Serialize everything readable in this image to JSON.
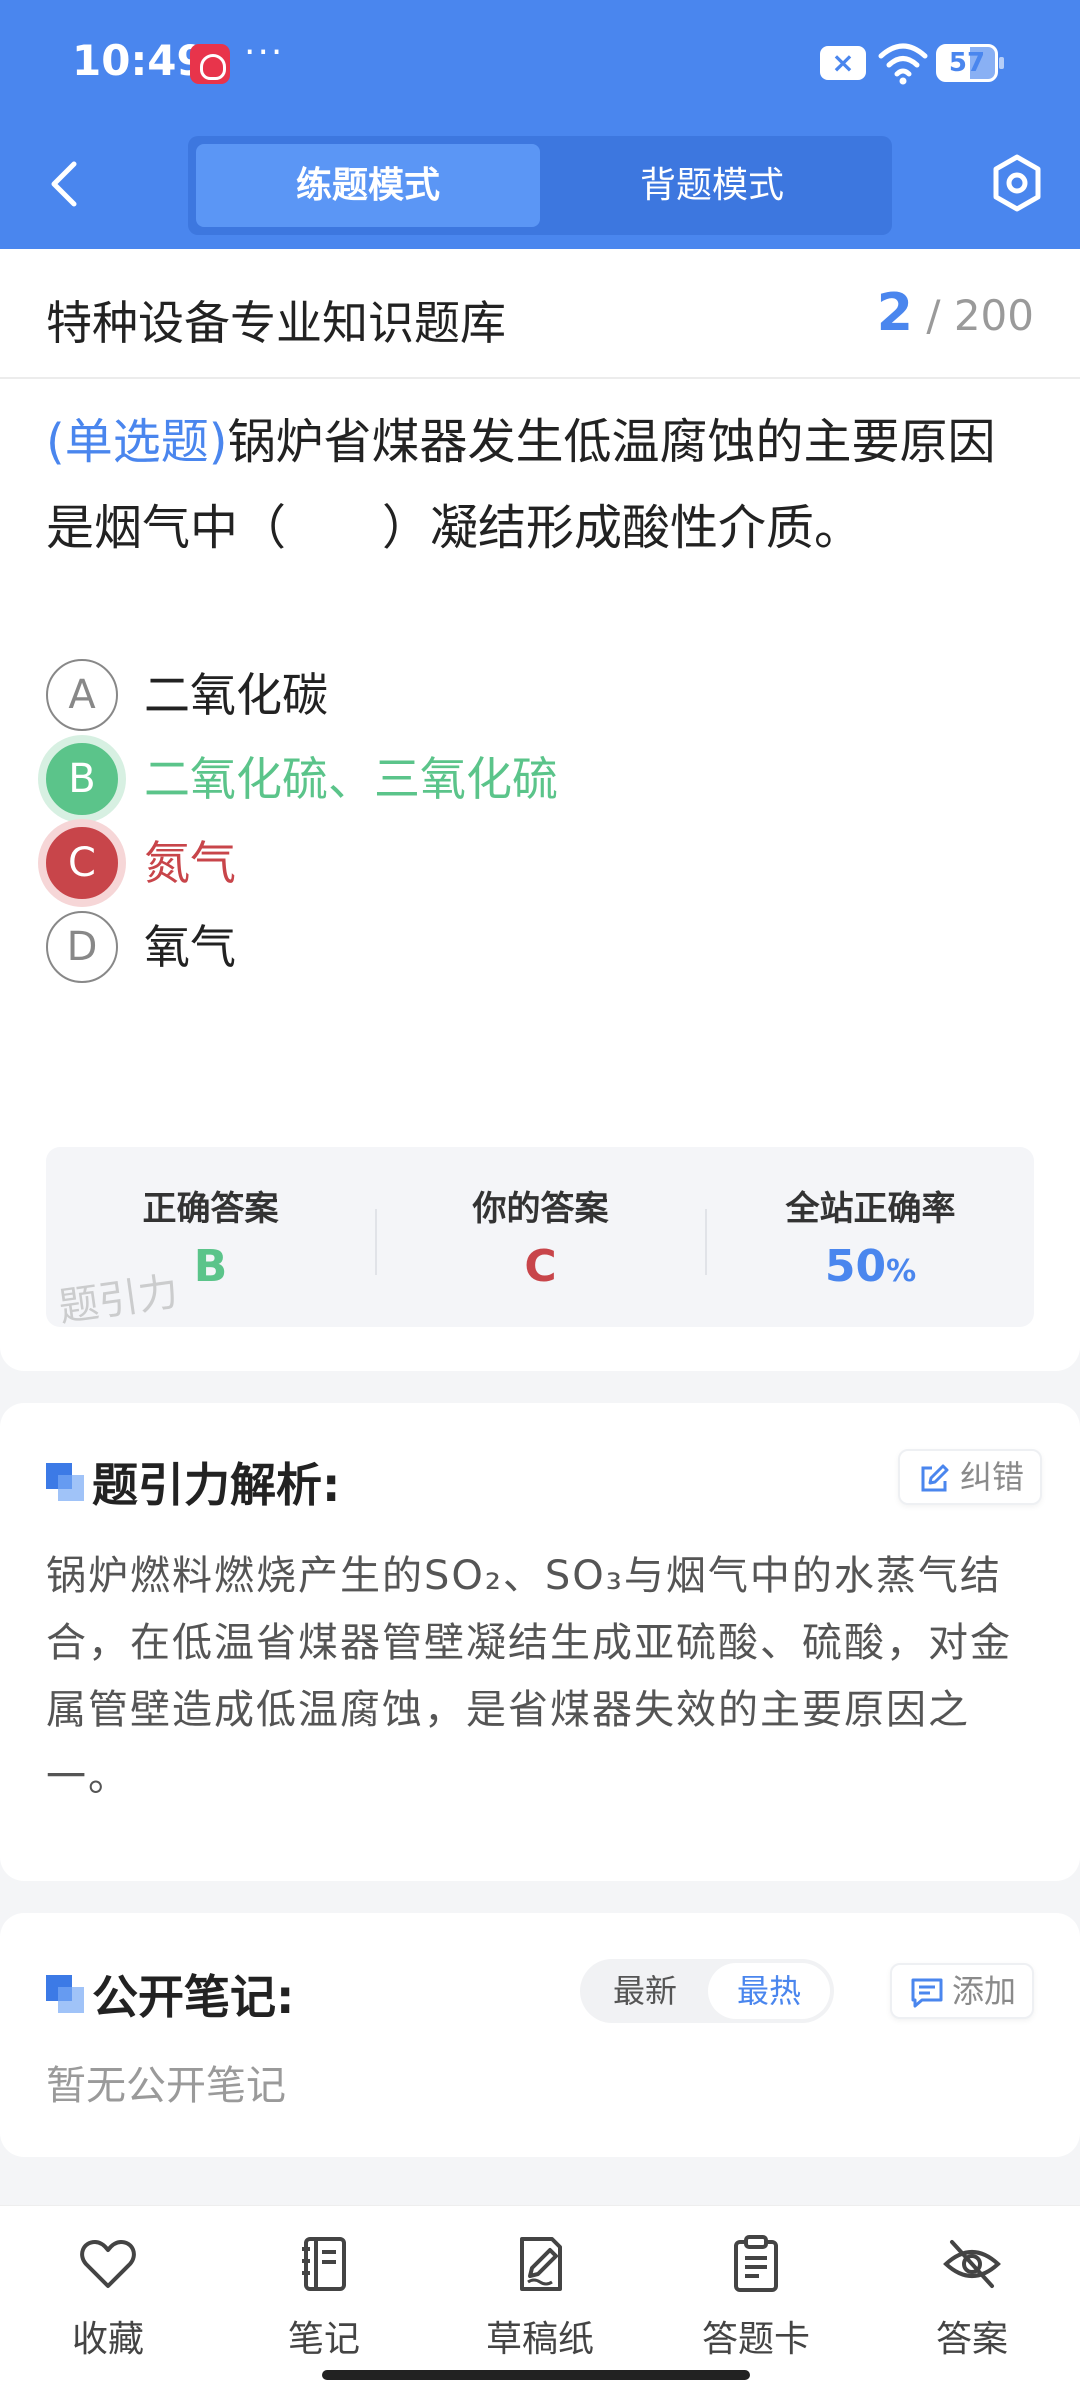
{
  "status_bar": {
    "time": "10:49",
    "dots": "···",
    "battery": "57"
  },
  "header": {
    "tabs": [
      {
        "label": "练题模式"
      },
      {
        "label": "背题模式"
      }
    ]
  },
  "bank": {
    "title": "特种设备专业知识题库",
    "current": "2",
    "total": "/ 200"
  },
  "question": {
    "type_label": "(单选题)",
    "text": "锅炉省煤器发生低温腐蚀的主要原因是烟气中（　　）凝结形成酸性介质。",
    "options": [
      {
        "letter": "A",
        "text": "二氧化碳",
        "state": "normal"
      },
      {
        "letter": "B",
        "text": "二氧化硫、三氧化硫",
        "state": "correct"
      },
      {
        "letter": "C",
        "text": "氮气",
        "state": "wrong"
      },
      {
        "letter": "D",
        "text": "氧气",
        "state": "normal"
      }
    ]
  },
  "answer_summary": {
    "correct_label": "正确答案",
    "correct_value": "B",
    "yours_label": "你的答案",
    "yours_value": "C",
    "rate_label": "全站正确率",
    "rate_value": "50",
    "rate_unit": "%",
    "watermark": "题引力"
  },
  "analysis": {
    "title": "题引力解析:",
    "report_label": "纠错",
    "text": "锅炉燃料燃烧产生的SO₂、SO₃与烟气中的水蒸气结合，在低温省煤器管壁凝结生成亚硫酸、硫酸，对金属管壁造成低温腐蚀，是省煤器失效的主要原因之一。"
  },
  "notes": {
    "title": "公开笔记:",
    "sort_newest": "最新",
    "sort_hottest": "最热",
    "add_label": "添加",
    "empty_text": "暂无公开笔记"
  },
  "bottom_nav": [
    {
      "label": "收藏",
      "icon": "heart-icon"
    },
    {
      "label": "笔记",
      "icon": "notebook-icon"
    },
    {
      "label": "草稿纸",
      "icon": "draft-paper-icon"
    },
    {
      "label": "答题卡",
      "icon": "answer-sheet-icon"
    },
    {
      "label": "答案",
      "icon": "eye-off-icon"
    }
  ],
  "colors": {
    "brand": "#4a86ee",
    "correct": "#5bc48a",
    "wrong": "#c8454a"
  }
}
